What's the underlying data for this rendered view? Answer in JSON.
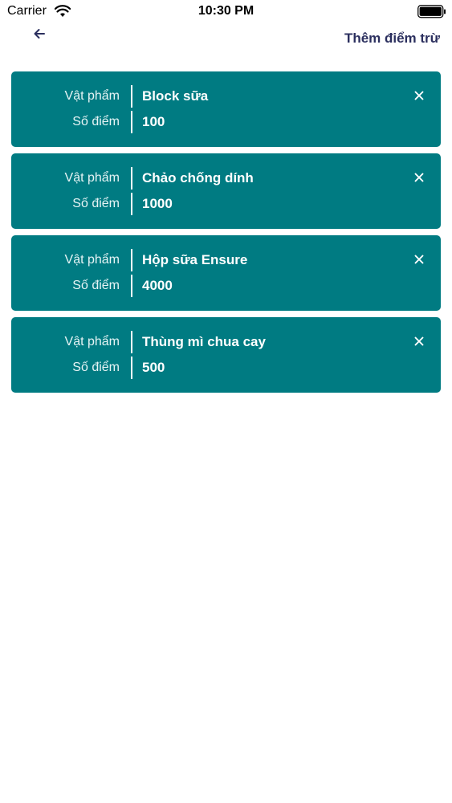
{
  "status_bar": {
    "carrier": "Carrier",
    "time": "10:30 PM"
  },
  "nav": {
    "back_icon": "arrow-left-icon",
    "action_label": "Thêm điểm trừ"
  },
  "items": [
    {
      "item_label": "Vật phẩm",
      "item_value": "Block sữa",
      "points_label": "Số điểm",
      "points_value": "100"
    },
    {
      "item_label": "Vật phẩm",
      "item_value": "Chảo chống dính",
      "points_label": "Số điểm",
      "points_value": "1000"
    },
    {
      "item_label": "Vật phẩm",
      "item_value": "Hộp sữa Ensure",
      "points_label": "Số điểm",
      "points_value": "4000"
    },
    {
      "item_label": "Vật phẩm",
      "item_value": "Thùng mì chua cay",
      "points_label": "Số điểm",
      "points_value": "500"
    }
  ],
  "colors": {
    "card_background": "#007b82",
    "nav_text": "#2b2f5e"
  }
}
